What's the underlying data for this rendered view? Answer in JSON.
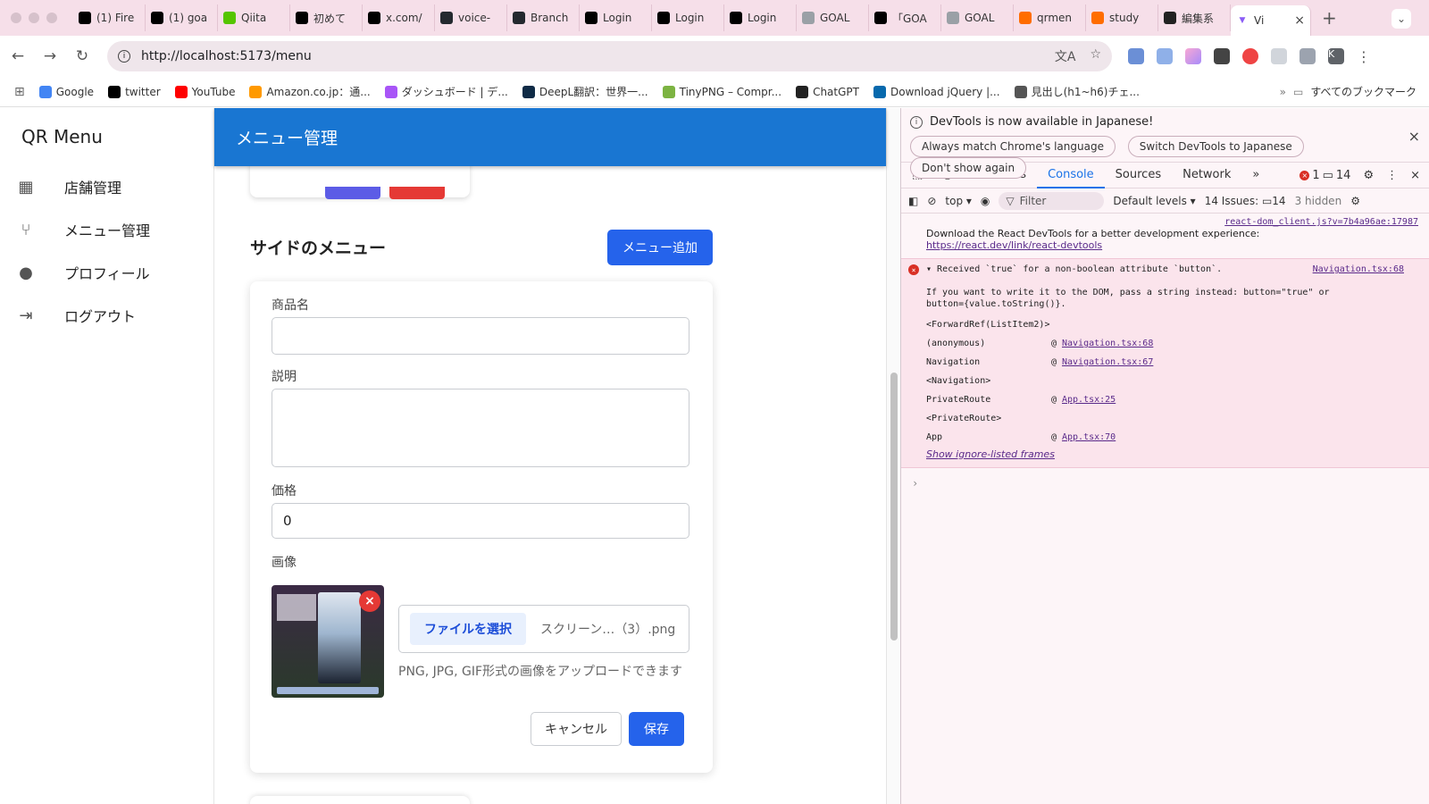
{
  "browser": {
    "tabs": [
      {
        "label": "(1) Fire",
        "icon_color": "#000000"
      },
      {
        "label": "(1) goa",
        "icon_color": "#000000"
      },
      {
        "label": "Qiita",
        "icon_color": "#55c500"
      },
      {
        "label": "初めて",
        "icon_color": "#000000"
      },
      {
        "label": "x.com/",
        "icon_color": "#000000"
      },
      {
        "label": "voice-",
        "icon_color": "#24292f"
      },
      {
        "label": "Branch",
        "icon_color": "#24292f"
      },
      {
        "label": "Login",
        "icon_color": "#000000"
      },
      {
        "label": "Login",
        "icon_color": "#000000"
      },
      {
        "label": "Login",
        "icon_color": "#000000"
      },
      {
        "label": "GOAL",
        "icon_color": "#9aa0a6"
      },
      {
        "label": "「GOA",
        "icon_color": "#000000"
      },
      {
        "label": "GOAL",
        "icon_color": "#9aa0a6"
      },
      {
        "label": "qrmen",
        "icon_color": "#ff6d00"
      },
      {
        "label": "study",
        "icon_color": "#ff6d00"
      },
      {
        "label": "編集系",
        "icon_color": "#222222"
      }
    ],
    "active_tab": {
      "label": "Vi",
      "icon_color": "#8b5cf6"
    },
    "url": "http://localhost:5173/menu",
    "profile_initial": "K",
    "bookmarks": [
      {
        "label": "Google",
        "icon_color": "#4285f4"
      },
      {
        "label": "twitter",
        "icon_color": "#000000"
      },
      {
        "label": "YouTube",
        "icon_color": "#ff0000"
      },
      {
        "label": "Amazon.co.jp：通...",
        "icon_color": "#ff9900"
      },
      {
        "label": "ダッシュボード | デ...",
        "icon_color": "#a855f7"
      },
      {
        "label": "DeepL翻訳：世界一...",
        "icon_color": "#0f2b46"
      },
      {
        "label": "TinyPNG – Compr...",
        "icon_color": "#7cb342"
      },
      {
        "label": "ChatGPT",
        "icon_color": "#222222"
      },
      {
        "label": "Download jQuery |...",
        "icon_color": "#0769ad"
      },
      {
        "label": "見出し(h1~h6)チェ...",
        "icon_color": "#555555"
      }
    ],
    "all_bookmarks": "すべてのブックマーク"
  },
  "app": {
    "brand": "QR Menu",
    "nav": [
      {
        "label": "店舗管理",
        "icon": "store-icon"
      },
      {
        "label": "メニュー管理",
        "icon": "restaurant-icon"
      },
      {
        "label": "プロフィール",
        "icon": "person-icon"
      },
      {
        "label": "ログアウト",
        "icon": "logout-icon"
      }
    ],
    "appbar_title": "メニュー管理",
    "section_title": "サイドのメニュー",
    "add_menu_button": "メニュー追加",
    "form": {
      "name_label": "商品名",
      "name_value": "",
      "description_label": "説明",
      "description_value": "",
      "price_label": "価格",
      "price_value": "0",
      "image_label": "画像",
      "file_button": "ファイルを選択",
      "file_name": "スクリーン…（3）.png",
      "hint": "PNG, JPG, GIF形式の画像をアップロードできます",
      "cancel": "キャンセル",
      "save": "保存"
    },
    "colors": {
      "primary": "#2563eb",
      "appbar": "#1976d2",
      "danger": "#e53935"
    }
  },
  "devtools": {
    "banner": "DevTools is now available in Japanese!",
    "banner_buttons": [
      "Always match Chrome's language",
      "Switch DevTools to Japanese",
      "Don't show again"
    ],
    "tabs": [
      "Elements",
      "Console",
      "Sources",
      "Network"
    ],
    "active_tab": "Console",
    "error_count": "1",
    "message_count": "14",
    "context": "top",
    "filter_placeholder": "Filter",
    "levels": "Default levels",
    "issues_label": "14 Issues:",
    "issues_count": "14",
    "hidden": "3 hidden",
    "log1_source": "react-dom_client.js?v=7b4a96ae:17987",
    "log1_text": "Download the React DevTools for a better development experience:",
    "log1_link": "https://react.dev/link/react-devtools",
    "error_title": "Received `true` for a non-boolean attribute `button`.",
    "error_source": "Navigation.tsx:68",
    "error_detail": "If you want to write it to the DOM, pass a string instead: button=\"true\" or button={value.toString()}.",
    "stack": [
      {
        "a": "<ForwardRef(ListItem2)>",
        "b": "",
        "c": ""
      },
      {
        "a": "(anonymous)",
        "b": "@",
        "c": "Navigation.tsx:68"
      },
      {
        "a": "Navigation",
        "b": "@",
        "c": "Navigation.tsx:67"
      },
      {
        "a": "<Navigation>",
        "b": "",
        "c": ""
      },
      {
        "a": "PrivateRoute",
        "b": "@",
        "c": "App.tsx:25"
      },
      {
        "a": "<PrivateRoute>",
        "b": "",
        "c": ""
      },
      {
        "a": "App",
        "b": "@",
        "c": "App.tsx:70"
      }
    ],
    "show_ignored": "Show ignore-listed frames"
  }
}
